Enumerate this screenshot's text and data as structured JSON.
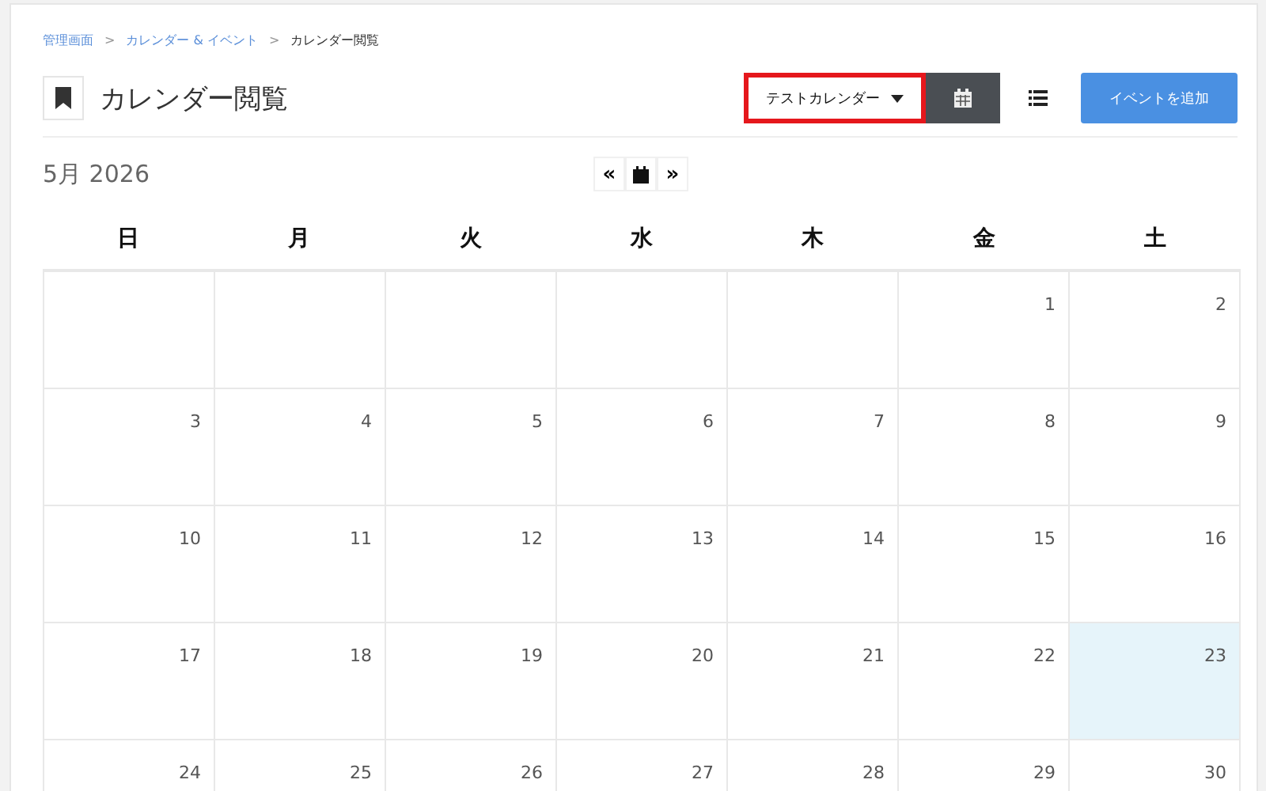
{
  "breadcrumb": [
    {
      "label": "管理画面",
      "link": true
    },
    {
      "label": "カレンダー & イベント",
      "link": true
    },
    {
      "label": "カレンダー閲覧",
      "link": false
    }
  ],
  "breadcrumb_separator": ">",
  "page_title": "カレンダー閲覧",
  "calendar_dropdown": {
    "label": "テストカレンダー",
    "highlighted": true
  },
  "view_buttons": [
    {
      "kind": "calendar",
      "selected": true
    },
    {
      "kind": "list",
      "selected": false
    }
  ],
  "add_event_button": "イベントを追加",
  "month_label": "5月 2026",
  "nav": {
    "prev": "«",
    "next": "»"
  },
  "weekdays": [
    "日",
    "月",
    "火",
    "水",
    "木",
    "金",
    "土"
  ],
  "weeks": [
    [
      {
        "kind": "blank"
      },
      {
        "kind": "blank"
      },
      {
        "kind": "blank"
      },
      {
        "kind": "blank"
      },
      {
        "kind": "blank"
      },
      {
        "kind": "day",
        "day": "1",
        "today": false
      },
      {
        "kind": "day",
        "day": "2",
        "today": false
      }
    ],
    [
      {
        "kind": "day",
        "day": "3",
        "today": false
      },
      {
        "kind": "day",
        "day": "4",
        "today": false
      },
      {
        "kind": "day",
        "day": "5",
        "today": false
      },
      {
        "kind": "day",
        "day": "6",
        "today": false
      },
      {
        "kind": "day",
        "day": "7",
        "today": false
      },
      {
        "kind": "day",
        "day": "8",
        "today": false
      },
      {
        "kind": "day",
        "day": "9",
        "today": false
      }
    ],
    [
      {
        "kind": "day",
        "day": "10",
        "today": false
      },
      {
        "kind": "day",
        "day": "11",
        "today": false
      },
      {
        "kind": "day",
        "day": "12",
        "today": false
      },
      {
        "kind": "day",
        "day": "13",
        "today": false
      },
      {
        "kind": "day",
        "day": "14",
        "today": false
      },
      {
        "kind": "day",
        "day": "15",
        "today": false
      },
      {
        "kind": "day",
        "day": "16",
        "today": false
      }
    ],
    [
      {
        "kind": "day",
        "day": "17",
        "today": false
      },
      {
        "kind": "day",
        "day": "18",
        "today": false
      },
      {
        "kind": "day",
        "day": "19",
        "today": false
      },
      {
        "kind": "day",
        "day": "20",
        "today": false
      },
      {
        "kind": "day",
        "day": "21",
        "today": false
      },
      {
        "kind": "day",
        "day": "22",
        "today": false
      },
      {
        "kind": "day",
        "day": "23",
        "today": true
      }
    ],
    [
      {
        "kind": "day",
        "day": "24",
        "today": false
      },
      {
        "kind": "day",
        "day": "25",
        "today": false
      },
      {
        "kind": "day",
        "day": "26",
        "today": false
      },
      {
        "kind": "day",
        "day": "27",
        "today": false
      },
      {
        "kind": "day",
        "day": "28",
        "today": false
      },
      {
        "kind": "day",
        "day": "29",
        "today": false
      },
      {
        "kind": "day",
        "day": "30",
        "today": false
      }
    ]
  ]
}
